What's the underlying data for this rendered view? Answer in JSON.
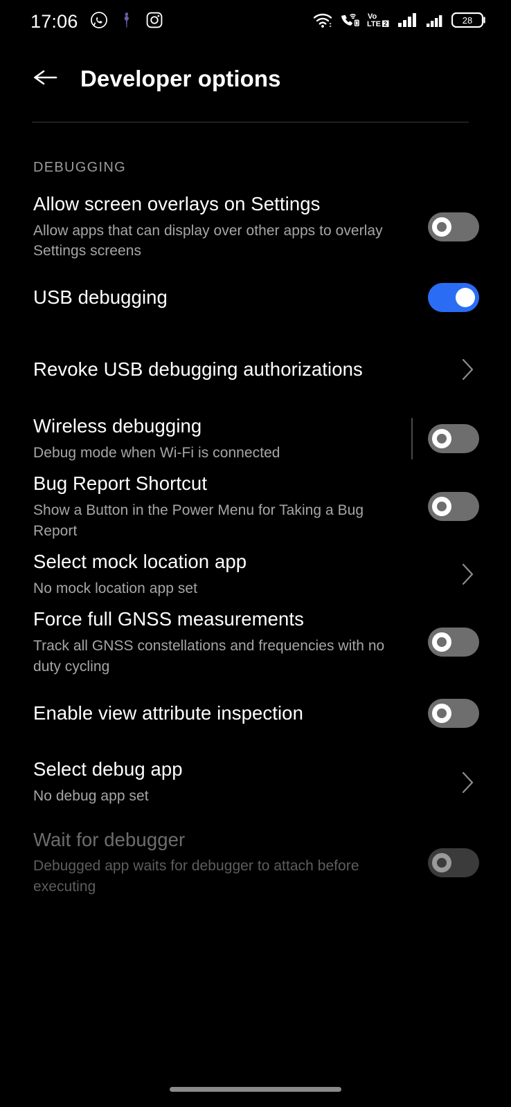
{
  "status_bar": {
    "clock": "17:06",
    "left_icons": [
      {
        "name": "whatsapp-icon",
        "label": "WhatsApp"
      },
      {
        "name": "notification-icon",
        "label": "Notification"
      },
      {
        "name": "instagram-icon",
        "label": "Instagram"
      }
    ],
    "right_icons": [
      {
        "name": "wifi-icon",
        "label": "Wi-Fi"
      },
      {
        "name": "volte-call-icon",
        "label": "Wi-Fi calling"
      },
      {
        "name": "volte-icon",
        "label": "VoLTE 2"
      },
      {
        "name": "signal-sim1-icon",
        "label": "Signal SIM 1"
      },
      {
        "name": "signal-sim2-icon",
        "label": "Signal SIM 2"
      },
      {
        "name": "battery-icon",
        "label": "Battery"
      }
    ],
    "volte_top_text": "Vo",
    "volte_bottom_text": "LTE",
    "volte_sim_text": "2",
    "battery_level": "28"
  },
  "header": {
    "title": "Developer options",
    "back_icon": "back-arrow-icon"
  },
  "sections": [
    {
      "label": "DEBUGGING"
    }
  ],
  "items": [
    {
      "title": "Allow screen overlays on Settings",
      "summary": "Allow apps that can display over other apps to overlay Settings screens",
      "control": "toggle",
      "state": "off"
    },
    {
      "title": "USB debugging",
      "summary": "",
      "control": "toggle",
      "state": "on"
    },
    {
      "title": "Revoke USB debugging authorizations",
      "summary": "",
      "control": "chevron",
      "state": ""
    },
    {
      "title": "Wireless debugging",
      "summary": "Debug mode when Wi-Fi is connected",
      "control": "toggle-with-divider",
      "state": "off"
    },
    {
      "title": "Bug Report Shortcut",
      "summary": "Show a Button in the Power Menu for Taking a Bug Report",
      "control": "toggle",
      "state": "off"
    },
    {
      "title": "Select mock location app",
      "summary": "No mock location app set",
      "control": "chevron",
      "state": ""
    },
    {
      "title": "Force full GNSS measurements",
      "summary": "Track all GNSS constellations and frequencies with no duty cycling",
      "control": "toggle",
      "state": "off"
    },
    {
      "title": "Enable view attribute inspection",
      "summary": "",
      "control": "toggle",
      "state": "off"
    },
    {
      "title": "Select debug app",
      "summary": "No debug app set",
      "control": "chevron",
      "state": ""
    },
    {
      "title": "Wait for debugger",
      "summary": "Debugged app waits for debugger to attach before executing",
      "control": "toggle",
      "state": "off-disabled"
    }
  ],
  "colors": {
    "background": "#000000",
    "accent_on": "#2a6df4",
    "toggle_off_track": "#6e6e6e",
    "toggle_disabled_track": "#3b3b3b",
    "summary_text": "#a6a6a6",
    "section_label": "#9b9b9b"
  },
  "nav": {
    "pill": "gesture-nav-pill"
  }
}
